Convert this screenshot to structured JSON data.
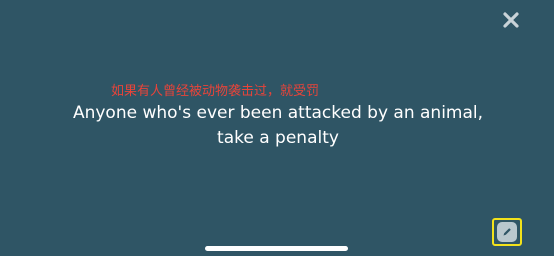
{
  "window": {
    "close_icon": "close-icon",
    "edit_icon": "pencil-icon"
  },
  "card": {
    "annotation": "如果有人曾经被动物袭击过，就受罚",
    "prompt": "Anyone who's ever been attacked by an animal, take a penalty"
  },
  "colors": {
    "background": "#2f5565",
    "annotation_text": "#e8443a",
    "highlight_border": "#f2e21b"
  }
}
